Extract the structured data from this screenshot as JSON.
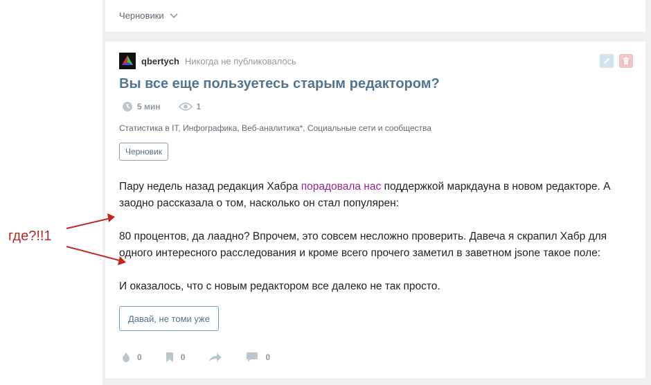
{
  "drafts_toggle": {
    "label": "Черновики"
  },
  "post": {
    "author": "qbertych",
    "publish_status": "Никогда не публиковалось",
    "title": "Вы все еще пользуетесь старым редактором?",
    "reading_time": "5 мин",
    "views": "1",
    "hubs": "Статистика в IT, Инфографика, Веб-аналитика*, Социальные сети и сообщества",
    "badge": "Черновик",
    "body": {
      "p1_before": "Пару недель назад редакция Хабра ",
      "p1_link": "порадовала нас",
      "p1_after": " поддержкой маркдауна в новом редакторе. А заодно рассказала о том, насколько он стал популярен:",
      "p2": "80 процентов, да лаадно? Впрочем, это совсем несложно проверить. Давеча я скрапил Хабр для одного интересного расследования и кроме всего прочего заметил в заветном jsone такое поле:",
      "p3": "И оказалось, что с новым редактором все далеко не так просто."
    },
    "read_more": "Давай, не томи уже",
    "footer": {
      "votes": "0",
      "bookmarks": "0",
      "comments": "0"
    }
  },
  "annotation": {
    "text": "где?!!1",
    "color": "#c0271f"
  },
  "icons": {
    "drafts_toggle": "chevron-down-icon",
    "edit": "pencil-icon",
    "delete": "trash-icon",
    "reading_time": "clock-icon",
    "views": "eye-icon",
    "votes": "drop-icon",
    "bookmarks": "bookmark-icon",
    "share": "share-arrow-icon",
    "comments": "comment-bubble-icon"
  }
}
